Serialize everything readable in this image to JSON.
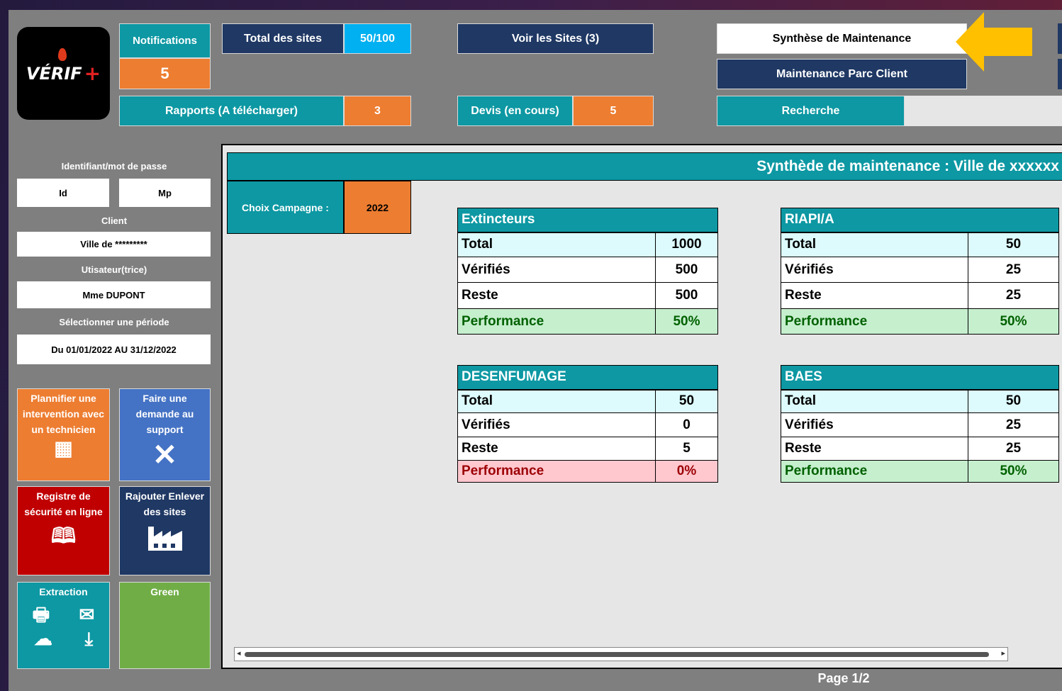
{
  "logo": {
    "text": "VÉRIF",
    "plus": "+"
  },
  "header": {
    "notifications_label": "Notifications",
    "notifications_count": "5",
    "total_sites_label": "Total des sites",
    "total_sites_value": "50/100",
    "voir_sites_label": "Voir les Sites (3)",
    "synthese_label": "Synthèse de Maintenance",
    "parc_label": "Maintenance Parc Client",
    "rapports_label": "Rapports (A télécharger)",
    "rapports_count": "3",
    "devis_label": "Devis (en cours)",
    "devis_count": "5",
    "recherche_label": "Recherche"
  },
  "sidebar": {
    "login_label": "Identifiant/mot de passe",
    "id_label": "Id",
    "mp_label": "Mp",
    "client_label": "Client",
    "client_value": "Ville de *********",
    "user_label": "Utisateur(trice)",
    "user_value": "Mme DUPONT",
    "period_label": "Sélectionner une période",
    "period_value": "Du 01/01/2022 AU 31/12/2022"
  },
  "tiles": {
    "plan": "Plannifier une intervention avec un technicien",
    "support": "Faire une demande au support",
    "registre": "Registre de sécurité en ligne",
    "sites": "Rajouter Enlever des sites",
    "extraction": "Extraction",
    "green": "Green"
  },
  "sheet": {
    "banner": "Synthède de maintenance : Ville de xxxxxx",
    "campaign_label": "Choix Campagne :",
    "campaign_value": "2022",
    "page": "Page 1/2",
    "tables": [
      {
        "title": "Extincteurs",
        "rows": [
          [
            "Total",
            "1000"
          ],
          [
            "Vérifiés",
            "500"
          ],
          [
            "Reste",
            "500"
          ],
          [
            "Performance",
            "50%"
          ]
        ]
      },
      {
        "title": "RIAPI/A",
        "rows": [
          [
            "Total",
            "50"
          ],
          [
            "Vérifiés",
            "25"
          ],
          [
            "Reste",
            "25"
          ],
          [
            "Performance",
            "50%"
          ]
        ]
      },
      {
        "title": "DESENFUMAGE",
        "rows": [
          [
            "Total",
            "50"
          ],
          [
            "Vérifiés",
            "0"
          ],
          [
            "Reste",
            "5"
          ],
          [
            "Performance",
            "0%"
          ]
        ]
      },
      {
        "title": "BAES",
        "rows": [
          [
            "Total",
            "50"
          ],
          [
            "Vérifiés",
            "25"
          ],
          [
            "Reste",
            "25"
          ],
          [
            "Performance",
            "50%"
          ]
        ]
      }
    ]
  },
  "colors": {
    "teal": "#0d98a3",
    "navy": "#1f3864",
    "orange": "#ed7d31",
    "arrow": "#ffc000"
  }
}
